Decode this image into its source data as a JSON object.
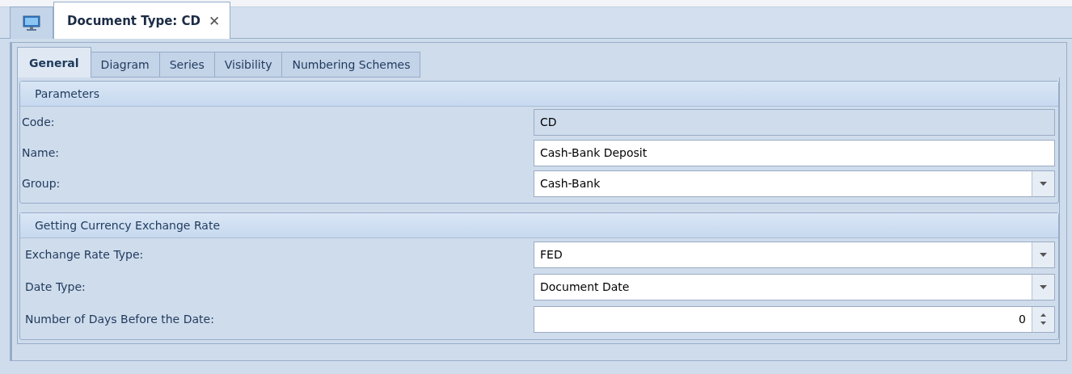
{
  "document_tab": {
    "title": "Document Type: CD",
    "close": "✕"
  },
  "tabs": [
    {
      "label": "General",
      "selected": true
    },
    {
      "label": "Diagram",
      "selected": false
    },
    {
      "label": "Series",
      "selected": false
    },
    {
      "label": "Visibility",
      "selected": false
    },
    {
      "label": "Numbering Schemes",
      "selected": false
    }
  ],
  "groups": [
    {
      "title": "Parameters",
      "fields": [
        {
          "label": "Code:",
          "kind": "readonly",
          "value": "CD"
        },
        {
          "label": "Name:",
          "kind": "text",
          "value": "Cash-Bank Deposit"
        },
        {
          "label": "Group:",
          "kind": "combo",
          "value": "Cash-Bank"
        }
      ]
    },
    {
      "title": "Getting Currency Exchange Rate",
      "fields": [
        {
          "label": "Exchange Rate Type:",
          "kind": "combo",
          "value": "FED"
        },
        {
          "label": "Date Type:",
          "kind": "combo",
          "value": "Document Date"
        },
        {
          "label": "Number of Days Before the Date:",
          "kind": "spin",
          "value": "0"
        }
      ]
    }
  ]
}
